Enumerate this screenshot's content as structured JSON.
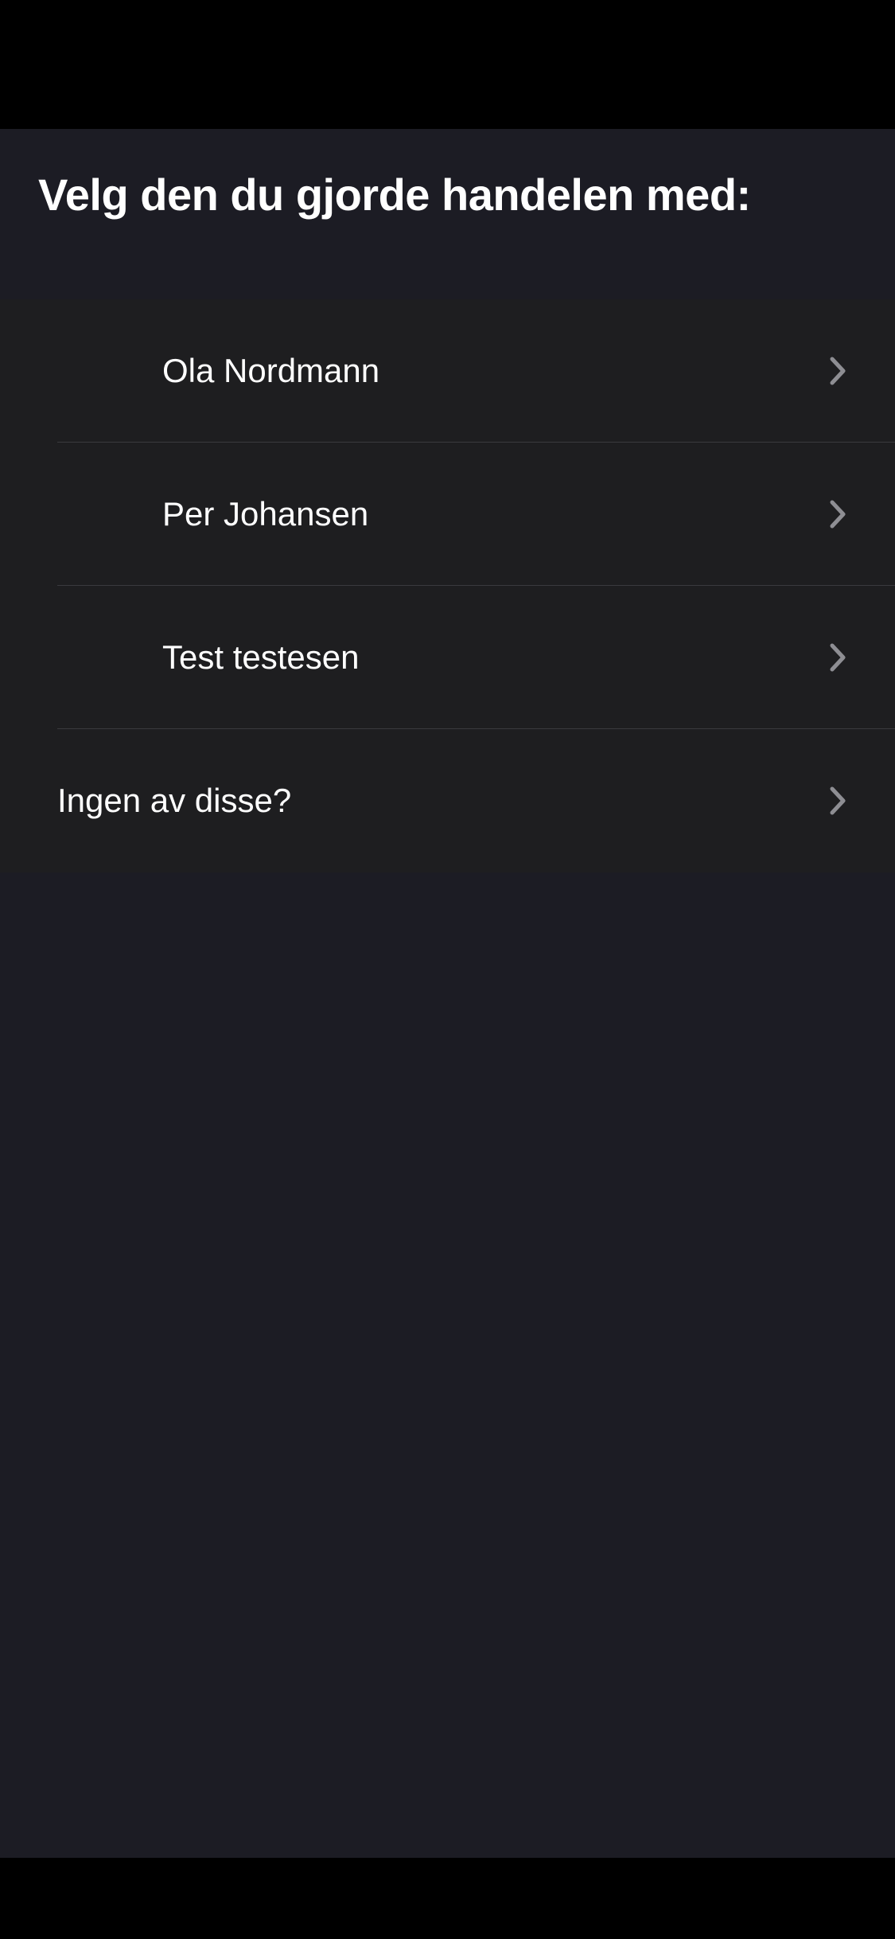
{
  "header": {
    "title": "Velg den du gjorde handelen med:"
  },
  "list": {
    "items": [
      {
        "label": "Ola Nordmann",
        "icon": "chevron-right-icon"
      },
      {
        "label": "Per Johansen",
        "icon": "chevron-right-icon"
      },
      {
        "label": "Test testesen",
        "icon": "chevron-right-icon"
      }
    ],
    "none_option": {
      "label": "Ingen av disse?",
      "icon": "chevron-right-icon"
    }
  },
  "colors": {
    "background": "#1c1c24",
    "list_background": "#1e1e20",
    "text": "#ffffff",
    "chevron": "#8e8e93",
    "divider": "#3a3a3e"
  }
}
